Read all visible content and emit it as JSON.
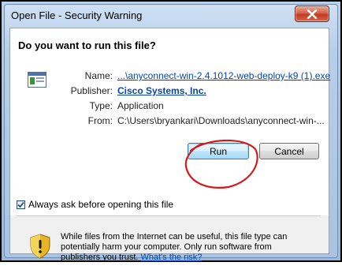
{
  "window": {
    "title": "Open File - Security Warning",
    "close_glyph": "X"
  },
  "dialog": {
    "question": "Do you want to run this file?",
    "fields": {
      "name_label": "Name:",
      "name_value": "...\\anyconnect-win-2.4.1012-web-deploy-k9 (1).exe",
      "publisher_label": "Publisher:",
      "publisher_value": "Cisco Systems, Inc.",
      "type_label": "Type:",
      "type_value": "Application",
      "from_label": "From:",
      "from_value": "C:\\Users\\bryankari\\Downloads\\anyconnect-win-..."
    },
    "buttons": {
      "run": "Run",
      "cancel": "Cancel"
    },
    "checkbox": {
      "label": "Always ask before opening this file",
      "checked": true
    },
    "warning": {
      "text_before_link": "While files from the Internet can be useful, this file type can potentially harm your computer. Only run software from publishers you trust. ",
      "link_text": "What's the risk?"
    }
  },
  "colors": {
    "link": "#0645ad",
    "annotation_circle": "#d41b1b",
    "close_button": "#c2381f"
  },
  "icons": {
    "file": "application-file-icon",
    "shield": "security-shield-warning-icon",
    "close": "close-icon"
  }
}
